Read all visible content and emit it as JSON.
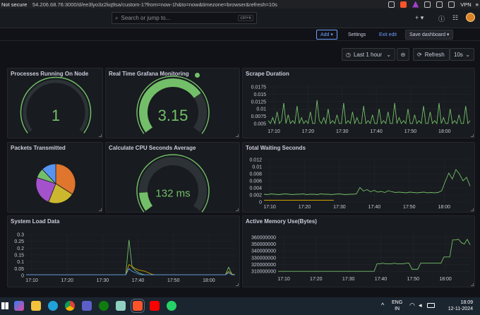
{
  "browser": {
    "security": "Not secure",
    "url": "54.206.68.76:3000/d/ee3lyo3z2kq9sa/custom-1?from=now-1h&to=now&timezone=browser&refresh=10s",
    "vpn": "VPN"
  },
  "grafana": {
    "search_placeholder": "Search or jump to...",
    "search_shortcut": "ctrl+k",
    "add_label": "Add",
    "settings_label": "Settings",
    "exit_edit_label": "Exit edit",
    "save_label": "Save dashboard",
    "time_range": "Last 1 hour",
    "refresh_label": "Refresh",
    "refresh_interval": "10s"
  },
  "panels": {
    "p1": {
      "title": "Processes Running On Node",
      "value": "1",
      "gauge_fraction": 0.0,
      "color": "#73bf69"
    },
    "p2": {
      "title": "Real Time Grafana Monitoring",
      "value": "3.15",
      "gauge_fraction": 0.72,
      "color": "#73bf69"
    },
    "p3": {
      "title": "Scrape Duration"
    },
    "p4": {
      "title": "Packets Transmitted"
    },
    "p5": {
      "title": "Calculate CPU Seconds Average",
      "value": "132 ms",
      "gauge_fraction": 0.13,
      "color": "#73bf69"
    },
    "p6": {
      "title": "Total Waiting Seconds"
    },
    "p7": {
      "title": "System Load Data"
    },
    "p8": {
      "title": "Active Memory Use(Bytes)"
    }
  },
  "chart_data": [
    {
      "type": "line",
      "panel": "Scrape Duration",
      "y_ticks": [
        "0.0175",
        "0.015",
        "0.0125",
        "0.01",
        "0.0075",
        "0.005"
      ],
      "ylim": [
        0.004,
        0.018
      ],
      "x_ticks": [
        "17:10",
        "17:20",
        "17:30",
        "17:40",
        "17:50",
        "18:00"
      ],
      "series": [
        {
          "color": "#73bf69",
          "values": [
            0.006,
            0.005,
            0.007,
            0.005,
            0.009,
            0.005,
            0.006,
            0.012,
            0.005,
            0.008,
            0.005,
            0.006,
            0.005,
            0.011,
            0.005,
            0.007,
            0.005,
            0.006,
            0.005,
            0.009,
            0.005,
            0.005,
            0.013,
            0.006,
            0.005,
            0.007,
            0.005,
            0.01,
            0.005,
            0.006,
            0.005,
            0.008,
            0.005,
            0.005,
            0.012,
            0.005,
            0.006,
            0.005,
            0.009,
            0.005,
            0.007,
            0.005,
            0.005,
            0.011,
            0.005,
            0.006,
            0.005,
            0.008,
            0.005,
            0.005,
            0.01,
            0.005,
            0.006,
            0.005,
            0.009,
            0.005,
            0.005,
            0.012,
            0.005,
            0.007,
            0.005,
            0.006,
            0.005,
            0.01,
            0.005,
            0.005,
            0.008,
            0.005,
            0.006,
            0.005,
            0.011,
            0.005,
            0.005,
            0.009,
            0.005,
            0.006,
            0.005,
            0.012,
            0.005,
            0.007,
            0.005,
            0.005,
            0.01,
            0.005,
            0.006,
            0.005,
            0.008,
            0.005,
            0.005,
            0.011,
            0.005,
            0.006
          ]
        }
      ]
    },
    {
      "type": "pie",
      "panel": "Packets Transmitted",
      "slices": [
        {
          "value": 34,
          "color": "#e0752d"
        },
        {
          "value": 22,
          "color": "#ccb82e"
        },
        {
          "value": 24,
          "color": "#a352cc"
        },
        {
          "value": 8,
          "color": "#73bf69"
        },
        {
          "value": 12,
          "color": "#5794f2"
        }
      ]
    },
    {
      "type": "line",
      "panel": "Total Waiting Seconds",
      "y_ticks": [
        "0.012",
        "0.01",
        "0.008",
        "0.006",
        "0.004",
        "0.002",
        "0"
      ],
      "ylim": [
        0,
        0.012
      ],
      "x_ticks": [
        "17:10",
        "17:20",
        "17:30",
        "17:40",
        "17:50",
        "18:00"
      ],
      "series": [
        {
          "color": "#73bf69",
          "values": [
            0.0022,
            0.0021,
            0.0023,
            0.0022,
            0.0021,
            0.0022,
            0.0023,
            0.0022,
            0.0021,
            0.0022,
            0.0022,
            0.0023,
            0.0021,
            0.0022,
            0.0022,
            0.0021,
            0.0023,
            0.0022,
            0.0022,
            0.0021,
            0.0022,
            0.0023,
            0.0022,
            0.0021,
            0.0022,
            0.0022,
            0.0023,
            0.0041,
            0.0031,
            0.0035,
            0.0029,
            0.0033,
            0.0028,
            0.003,
            0.0027,
            0.0032,
            0.0029,
            0.0027,
            0.0028,
            0.0027,
            0.0026,
            0.0028,
            0.0027,
            0.0026,
            0.0027,
            0.0028,
            0.0026,
            0.0027,
            0.0026,
            0.0027,
            0.0032,
            0.0058,
            0.0082,
            0.0065,
            0.0092,
            0.0079,
            0.006,
            0.007,
            0.0045
          ]
        },
        {
          "color": "#cca300",
          "values": [
            0.0005,
            0.0005,
            0.0005,
            0.0005,
            0.0005,
            0.0005,
            0.0005,
            0.0005,
            0.0005,
            0.0005,
            0.0005,
            0.0005,
            0.0005,
            0.0005,
            0.0005,
            0.0005,
            0.0005,
            0.0005,
            0.0005,
            0.0005
          ]
        }
      ]
    },
    {
      "type": "line",
      "panel": "System Load Data",
      "y_ticks": [
        "0.3",
        "0.25",
        "0.2",
        "0.15",
        "0.1",
        "0.05",
        "0"
      ],
      "ylim": [
        0,
        0.3
      ],
      "x_ticks": [
        "17:10",
        "17:20",
        "17:30",
        "17:40",
        "17:50",
        "18:00"
      ],
      "series": [
        {
          "color": "#73bf69",
          "values": [
            0.005,
            0.005,
            0.005,
            0.005,
            0.005,
            0.005,
            0.005,
            0.005,
            0.005,
            0.005,
            0.005,
            0.005,
            0.005,
            0.005,
            0.005,
            0.005,
            0.005,
            0.005,
            0.005,
            0.005,
            0.005,
            0.005,
            0.005,
            0.005,
            0.005,
            0.005,
            0.005,
            0.005,
            0.005,
            0.005,
            0.005,
            0.005,
            0.26,
            0.06,
            0.035,
            0.02,
            0.01,
            0.005,
            0.005,
            0.005,
            0.005,
            0.005,
            0.005,
            0.005,
            0.005,
            0.005,
            0.005,
            0.005,
            0.005,
            0.005,
            0.005,
            0.005,
            0.005,
            0.005,
            0.005,
            0.005,
            0.005,
            0.005,
            0.005,
            0.005,
            0.005,
            0.005,
            0.005,
            0.06,
            0.01,
            0.005
          ]
        },
        {
          "color": "#cca300",
          "values": [
            0.005,
            0.005,
            0.005,
            0.005,
            0.005,
            0.005,
            0.005,
            0.005,
            0.005,
            0.005,
            0.005,
            0.005,
            0.005,
            0.005,
            0.005,
            0.005,
            0.005,
            0.005,
            0.005,
            0.005,
            0.005,
            0.005,
            0.005,
            0.005,
            0.005,
            0.005,
            0.005,
            0.005,
            0.005,
            0.005,
            0.005,
            0.005,
            0.08,
            0.065,
            0.05,
            0.04,
            0.035,
            0.03,
            0.02,
            0.01,
            0.005,
            0.005,
            0.005,
            0.005,
            0.005,
            0.005,
            0.005,
            0.005,
            0.005,
            0.005,
            0.005,
            0.005,
            0.005,
            0.005,
            0.005,
            0.005,
            0.005,
            0.005,
            0.005,
            0.005,
            0.005,
            0.005,
            0.005,
            0.03,
            0.01,
            0.005
          ]
        },
        {
          "color": "#5794f2",
          "values": [
            0.005,
            0.005,
            0.005,
            0.005,
            0.005,
            0.005,
            0.005,
            0.005,
            0.005,
            0.005,
            0.005,
            0.005,
            0.005,
            0.005,
            0.005,
            0.005,
            0.005,
            0.005,
            0.005,
            0.005,
            0.005,
            0.005,
            0.005,
            0.005,
            0.005,
            0.005,
            0.005,
            0.005,
            0.005,
            0.005,
            0.005,
            0.005,
            0.05,
            0.03,
            0.02,
            0.01,
            0.005,
            0.005,
            0.005,
            0.005,
            0.005,
            0.005,
            0.005,
            0.005,
            0.005,
            0.005,
            0.005,
            0.005,
            0.005,
            0.005,
            0.005,
            0.005,
            0.005,
            0.005,
            0.005,
            0.005,
            0.005,
            0.005,
            0.005,
            0.005,
            0.005,
            0.005,
            0.005,
            0.02,
            0.005,
            0.005
          ]
        }
      ]
    },
    {
      "type": "line",
      "panel": "Active Memory Use(Bytes)",
      "y_ticks": [
        "360000000",
        "350000000",
        "340000000",
        "330000000",
        "320000000",
        "310000000"
      ],
      "ylim": [
        306000000,
        364000000
      ],
      "x_ticks": [
        "17:10",
        "17:20",
        "17:30",
        "17:40",
        "17:50",
        "18:00"
      ],
      "series": [
        {
          "color": "#73bf69",
          "values": [
            310000000,
            310000000,
            310000000,
            310000000,
            310000000,
            310000000,
            310000000,
            310000000,
            310000000,
            310000000,
            310000000,
            310000000,
            310000000,
            310000000,
            310000000,
            310000000,
            310000000,
            310000000,
            310000000,
            310000000,
            310000000,
            310000000,
            310000000,
            310000000,
            310000000,
            310000000,
            310000000,
            310000000,
            310000000,
            310000000,
            310000000,
            310000000,
            310000000,
            310000000,
            321000000,
            321000000,
            322000000,
            321000000,
            321000000,
            321000000,
            322000000,
            321000000,
            321000000,
            321000000,
            322000000,
            322000000,
            313000000,
            313000000,
            313000000,
            322000000,
            322000000,
            322000000,
            322000000,
            322000000,
            322000000,
            322000000,
            322000000,
            331000000,
            331000000,
            331000000,
            356000000,
            356000000,
            357000000,
            352000000,
            350000000,
            357000000,
            349000000
          ]
        }
      ]
    }
  ],
  "taskbar": {
    "lang_top": "ENG",
    "lang_bottom": "IN",
    "time": "18:09",
    "date": "12-11-2024"
  }
}
